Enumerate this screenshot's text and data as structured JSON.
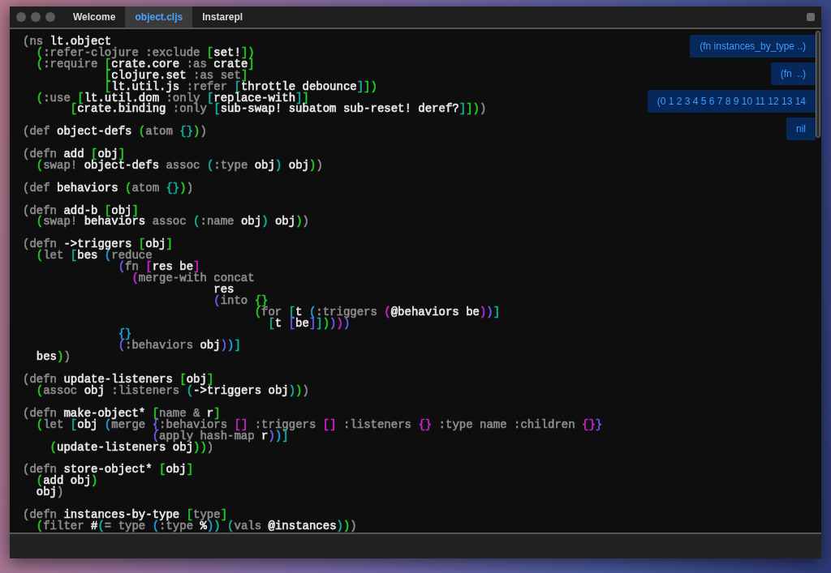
{
  "window": {
    "tabs": [
      {
        "label": "Welcome",
        "selected": false
      },
      {
        "label": "object.cljs",
        "selected": true
      },
      {
        "label": "Instarepl",
        "selected": false
      }
    ]
  },
  "editor": {
    "lines": [
      {
        "blank_before": false,
        "tokens": [
          {
            "text": "(ns ",
            "color": "#8c8c8c"
          },
          {
            "text": "lt.object",
            "color": "#e8e8e8"
          }
        ]
      },
      {
        "blank_before": false,
        "tokens": [
          {
            "text": "  (",
            "color": "#22cc22"
          },
          {
            "text": ":refer-clojure :exclude ",
            "color": "#8c8c8c"
          },
          {
            "text": "[",
            "color": "#22cc22"
          },
          {
            "text": "set!",
            "color": "#e8e8e8"
          },
          {
            "text": "])",
            "color": "#22cc22"
          }
        ]
      },
      {
        "blank_before": false,
        "tokens": [
          {
            "text": "  (",
            "color": "#22cc22"
          },
          {
            "text": ":require ",
            "color": "#8c8c8c"
          },
          {
            "text": "[",
            "color": "#22cc22"
          },
          {
            "text": "crate.core ",
            "color": "#e8e8e8"
          },
          {
            "text": ":as ",
            "color": "#8c8c8c"
          },
          {
            "text": "crate",
            "color": "#e8e8e8"
          },
          {
            "text": "]",
            "color": "#22cc22"
          }
        ]
      },
      {
        "blank_before": false,
        "tokens": [
          {
            "text": "            [",
            "color": "#22cc22"
          },
          {
            "text": "clojure.set ",
            "color": "#e8e8e8"
          },
          {
            "text": ":as set",
            "color": "#8c8c8c"
          },
          {
            "text": "]",
            "color": "#22cc22"
          }
        ]
      },
      {
        "blank_before": false,
        "tokens": [
          {
            "text": "            [",
            "color": "#22cc22"
          },
          {
            "text": "lt.util.js ",
            "color": "#e8e8e8"
          },
          {
            "text": ":refer ",
            "color": "#8c8c8c"
          },
          {
            "text": "[",
            "color": "#10b0a0"
          },
          {
            "text": "throttle debounce",
            "color": "#e8e8e8"
          },
          {
            "text": "]",
            "color": "#10b0a0"
          },
          {
            "text": "])",
            "color": "#22cc22"
          }
        ]
      },
      {
        "blank_before": false,
        "tokens": [
          {
            "text": "  (",
            "color": "#22cc22"
          },
          {
            "text": ":use ",
            "color": "#8c8c8c"
          },
          {
            "text": "[",
            "color": "#22cc22"
          },
          {
            "text": "lt.util.dom ",
            "color": "#e8e8e8"
          },
          {
            "text": ":only ",
            "color": "#8c8c8c"
          },
          {
            "text": "[",
            "color": "#10b0a0"
          },
          {
            "text": "replace-with",
            "color": "#e8e8e8"
          },
          {
            "text": "]",
            "color": "#10b0a0"
          },
          {
            "text": "]",
            "color": "#22cc22"
          }
        ]
      },
      {
        "blank_before": false,
        "tokens": [
          {
            "text": "       [",
            "color": "#22cc22"
          },
          {
            "text": "crate.binding ",
            "color": "#e8e8e8"
          },
          {
            "text": ":only ",
            "color": "#8c8c8c"
          },
          {
            "text": "[",
            "color": "#10b0a0"
          },
          {
            "text": "sub-swap! subatom sub-reset! deref?",
            "color": "#e8e8e8"
          },
          {
            "text": "]",
            "color": "#10b0a0"
          },
          {
            "text": "])",
            "color": "#22cc22"
          },
          {
            "text": ")",
            "color": "#8c8c8c"
          }
        ]
      },
      {
        "blank_before": true,
        "tokens": [
          {
            "text": "(def ",
            "color": "#8c8c8c"
          },
          {
            "text": "object-defs ",
            "color": "#e8e8e8"
          },
          {
            "text": "(",
            "color": "#22cc22"
          },
          {
            "text": "atom ",
            "color": "#8c8c8c"
          },
          {
            "text": "{}",
            "color": "#10b0a0"
          },
          {
            "text": ")",
            "color": "#22cc22"
          },
          {
            "text": ")",
            "color": "#8c8c8c"
          }
        ]
      },
      {
        "blank_before": true,
        "tokens": [
          {
            "text": "(defn ",
            "color": "#8c8c8c"
          },
          {
            "text": "add ",
            "color": "#e8e8e8"
          },
          {
            "text": "[",
            "color": "#22cc22"
          },
          {
            "text": "obj",
            "color": "#e8e8e8"
          },
          {
            "text": "]",
            "color": "#22cc22"
          }
        ]
      },
      {
        "blank_before": false,
        "tokens": [
          {
            "text": "  (",
            "color": "#22cc22"
          },
          {
            "text": "swap! ",
            "color": "#8c8c8c"
          },
          {
            "text": "object-defs ",
            "color": "#e8e8e8"
          },
          {
            "text": "assoc ",
            "color": "#8c8c8c"
          },
          {
            "text": "(",
            "color": "#10b0a0"
          },
          {
            "text": ":type ",
            "color": "#8c8c8c"
          },
          {
            "text": "obj",
            "color": "#e8e8e8"
          },
          {
            "text": ")",
            "color": "#10b0a0"
          },
          {
            "text": " obj",
            "color": "#e8e8e8"
          },
          {
            "text": ")",
            "color": "#22cc22"
          },
          {
            "text": ")",
            "color": "#8c8c8c"
          }
        ]
      },
      {
        "blank_before": true,
        "tokens": [
          {
            "text": "(def ",
            "color": "#8c8c8c"
          },
          {
            "text": "behaviors ",
            "color": "#e8e8e8"
          },
          {
            "text": "(",
            "color": "#22cc22"
          },
          {
            "text": "atom ",
            "color": "#8c8c8c"
          },
          {
            "text": "{}",
            "color": "#10b0a0"
          },
          {
            "text": ")",
            "color": "#22cc22"
          },
          {
            "text": ")",
            "color": "#8c8c8c"
          }
        ]
      },
      {
        "blank_before": true,
        "tokens": [
          {
            "text": "(defn ",
            "color": "#8c8c8c"
          },
          {
            "text": "add-b ",
            "color": "#e8e8e8"
          },
          {
            "text": "[",
            "color": "#22cc22"
          },
          {
            "text": "obj",
            "color": "#e8e8e8"
          },
          {
            "text": "]",
            "color": "#22cc22"
          }
        ]
      },
      {
        "blank_before": false,
        "tokens": [
          {
            "text": "  (",
            "color": "#22cc22"
          },
          {
            "text": "swap! ",
            "color": "#8c8c8c"
          },
          {
            "text": "behaviors ",
            "color": "#e8e8e8"
          },
          {
            "text": "assoc ",
            "color": "#8c8c8c"
          },
          {
            "text": "(",
            "color": "#10b0a0"
          },
          {
            "text": ":name ",
            "color": "#8c8c8c"
          },
          {
            "text": "obj",
            "color": "#e8e8e8"
          },
          {
            "text": ")",
            "color": "#10b0a0"
          },
          {
            "text": " obj",
            "color": "#e8e8e8"
          },
          {
            "text": ")",
            "color": "#22cc22"
          },
          {
            "text": ")",
            "color": "#8c8c8c"
          }
        ]
      },
      {
        "blank_before": true,
        "tokens": [
          {
            "text": "(defn ",
            "color": "#8c8c8c"
          },
          {
            "text": "->triggers ",
            "color": "#e8e8e8"
          },
          {
            "text": "[",
            "color": "#22cc22"
          },
          {
            "text": "obj",
            "color": "#e8e8e8"
          },
          {
            "text": "]",
            "color": "#22cc22"
          }
        ]
      },
      {
        "blank_before": false,
        "tokens": [
          {
            "text": "  (",
            "color": "#22cc22"
          },
          {
            "text": "let ",
            "color": "#8c8c8c"
          },
          {
            "text": "[",
            "color": "#10b0a0"
          },
          {
            "text": "bes ",
            "color": "#e8e8e8"
          },
          {
            "text": "(",
            "color": "#1aa0d8"
          },
          {
            "text": "reduce",
            "color": "#8c8c8c"
          }
        ]
      },
      {
        "blank_before": false,
        "tokens": [
          {
            "text": "              (",
            "color": "#6a5cf0"
          },
          {
            "text": "fn ",
            "color": "#8c8c8c"
          },
          {
            "text": "[",
            "color": "#d020d0"
          },
          {
            "text": "res be",
            "color": "#e8e8e8"
          },
          {
            "text": "]",
            "color": "#d020d0"
          }
        ]
      },
      {
        "blank_before": false,
        "tokens": [
          {
            "text": "                (",
            "color": "#d020d0"
          },
          {
            "text": "merge-with concat",
            "color": "#8c8c8c"
          }
        ]
      },
      {
        "blank_before": false,
        "tokens": [
          {
            "text": "                            res",
            "color": "#e8e8e8"
          }
        ]
      },
      {
        "blank_before": false,
        "tokens": [
          {
            "text": "                            (",
            "color": "#6a5cf0"
          },
          {
            "text": "into ",
            "color": "#8c8c8c"
          },
          {
            "text": "{}",
            "color": "#22cc22"
          }
        ]
      },
      {
        "blank_before": false,
        "tokens": [
          {
            "text": "                                  (",
            "color": "#22cc22"
          },
          {
            "text": "for ",
            "color": "#8c8c8c"
          },
          {
            "text": "[",
            "color": "#10b0a0"
          },
          {
            "text": "t ",
            "color": "#e8e8e8"
          },
          {
            "text": "(",
            "color": "#1aa0d8"
          },
          {
            "text": ":triggers ",
            "color": "#8c8c8c"
          },
          {
            "text": "(",
            "color": "#d020d0"
          },
          {
            "text": "@behaviors be",
            "color": "#e8e8e8"
          },
          {
            "text": ")",
            "color": "#d020d0"
          },
          {
            "text": ")",
            "color": "#6a5cf0"
          },
          {
            "text": "]",
            "color": "#10b0a0"
          }
        ]
      },
      {
        "blank_before": false,
        "tokens": [
          {
            "text": "                                    [",
            "color": "#10b0a0"
          },
          {
            "text": "t ",
            "color": "#e8e8e8"
          },
          {
            "text": "[",
            "color": "#6a5cf0"
          },
          {
            "text": "be",
            "color": "#e8e8e8"
          },
          {
            "text": "]",
            "color": "#6a5cf0"
          },
          {
            "text": "]",
            "color": "#10b0a0"
          },
          {
            "text": ")",
            "color": "#22cc22"
          },
          {
            "text": ")",
            "color": "#6a5cf0"
          },
          {
            "text": ")",
            "color": "#d020d0"
          },
          {
            "text": ")",
            "color": "#6a5cf0"
          }
        ]
      },
      {
        "blank_before": false,
        "tokens": [
          {
            "text": "              {}",
            "color": "#1aa0d8"
          }
        ]
      },
      {
        "blank_before": false,
        "tokens": [
          {
            "text": "              (",
            "color": "#6a5cf0"
          },
          {
            "text": ":behaviors ",
            "color": "#8c8c8c"
          },
          {
            "text": "obj",
            "color": "#e8e8e8"
          },
          {
            "text": ")",
            "color": "#6a5cf0"
          },
          {
            "text": ")",
            "color": "#1aa0d8"
          },
          {
            "text": "]",
            "color": "#10b0a0"
          }
        ]
      },
      {
        "blank_before": false,
        "tokens": [
          {
            "text": "  bes",
            "color": "#e8e8e8"
          },
          {
            "text": ")",
            "color": "#22cc22"
          },
          {
            "text": ")",
            "color": "#8c8c8c"
          }
        ]
      },
      {
        "blank_before": true,
        "tokens": [
          {
            "text": "(defn ",
            "color": "#8c8c8c"
          },
          {
            "text": "update-listeners ",
            "color": "#e8e8e8"
          },
          {
            "text": "[",
            "color": "#22cc22"
          },
          {
            "text": "obj",
            "color": "#e8e8e8"
          },
          {
            "text": "]",
            "color": "#22cc22"
          }
        ]
      },
      {
        "blank_before": false,
        "tokens": [
          {
            "text": "  (",
            "color": "#22cc22"
          },
          {
            "text": "assoc ",
            "color": "#8c8c8c"
          },
          {
            "text": "obj ",
            "color": "#e8e8e8"
          },
          {
            "text": ":listeners ",
            "color": "#8c8c8c"
          },
          {
            "text": "(",
            "color": "#10b0a0"
          },
          {
            "text": "->triggers obj",
            "color": "#e8e8e8"
          },
          {
            "text": ")",
            "color": "#10b0a0"
          },
          {
            "text": ")",
            "color": "#22cc22"
          },
          {
            "text": ")",
            "color": "#8c8c8c"
          }
        ]
      },
      {
        "blank_before": true,
        "tokens": [
          {
            "text": "(defn ",
            "color": "#8c8c8c"
          },
          {
            "text": "make-object* ",
            "color": "#e8e8e8"
          },
          {
            "text": "[",
            "color": "#22cc22"
          },
          {
            "text": "name & ",
            "color": "#8c8c8c"
          },
          {
            "text": "r",
            "color": "#e8e8e8"
          },
          {
            "text": "]",
            "color": "#22cc22"
          }
        ]
      },
      {
        "blank_before": false,
        "tokens": [
          {
            "text": "  (",
            "color": "#22cc22"
          },
          {
            "text": "let ",
            "color": "#8c8c8c"
          },
          {
            "text": "[",
            "color": "#10b0a0"
          },
          {
            "text": "obj ",
            "color": "#e8e8e8"
          },
          {
            "text": "(",
            "color": "#1aa0d8"
          },
          {
            "text": "merge ",
            "color": "#8c8c8c"
          },
          {
            "text": "{",
            "color": "#6a5cf0"
          },
          {
            "text": ":behaviors ",
            "color": "#8c8c8c"
          },
          {
            "text": "[]",
            "color": "#d020d0"
          },
          {
            "text": " :triggers ",
            "color": "#8c8c8c"
          },
          {
            "text": "[]",
            "color": "#d020d0"
          },
          {
            "text": " :listeners ",
            "color": "#8c8c8c"
          },
          {
            "text": "{}",
            "color": "#d020d0"
          },
          {
            "text": " :type name :children ",
            "color": "#8c8c8c"
          },
          {
            "text": "{}",
            "color": "#d020d0"
          },
          {
            "text": "}",
            "color": "#6a5cf0"
          }
        ]
      },
      {
        "blank_before": false,
        "tokens": [
          {
            "text": "                   (",
            "color": "#6a5cf0"
          },
          {
            "text": "apply hash-map ",
            "color": "#8c8c8c"
          },
          {
            "text": "r",
            "color": "#e8e8e8"
          },
          {
            "text": ")",
            "color": "#6a5cf0"
          },
          {
            "text": ")",
            "color": "#1aa0d8"
          },
          {
            "text": "]",
            "color": "#10b0a0"
          }
        ]
      },
      {
        "blank_before": false,
        "tokens": [
          {
            "text": "    (",
            "color": "#22cc22"
          },
          {
            "text": "update-listeners obj",
            "color": "#e8e8e8"
          },
          {
            "text": "))",
            "color": "#22cc22"
          },
          {
            "text": ")",
            "color": "#8c8c8c"
          }
        ]
      },
      {
        "blank_before": true,
        "tokens": [
          {
            "text": "(defn ",
            "color": "#8c8c8c"
          },
          {
            "text": "store-object* ",
            "color": "#e8e8e8"
          },
          {
            "text": "[",
            "color": "#22cc22"
          },
          {
            "text": "obj",
            "color": "#e8e8e8"
          },
          {
            "text": "]",
            "color": "#22cc22"
          }
        ]
      },
      {
        "blank_before": false,
        "tokens": [
          {
            "text": "  (",
            "color": "#22cc22"
          },
          {
            "text": "add obj",
            "color": "#e8e8e8"
          },
          {
            "text": ")",
            "color": "#22cc22"
          }
        ]
      },
      {
        "blank_before": false,
        "tokens": [
          {
            "text": "  obj",
            "color": "#e8e8e8"
          },
          {
            "text": ")",
            "color": "#8c8c8c"
          }
        ]
      },
      {
        "blank_before": true,
        "tokens": [
          {
            "text": "(defn ",
            "color": "#8c8c8c"
          },
          {
            "text": "instances-by-type ",
            "color": "#e8e8e8"
          },
          {
            "text": "[",
            "color": "#22cc22"
          },
          {
            "text": "type",
            "color": "#8c8c8c"
          },
          {
            "text": "]",
            "color": "#22cc22"
          }
        ]
      },
      {
        "blank_before": false,
        "tokens": [
          {
            "text": "  (",
            "color": "#22cc22"
          },
          {
            "text": "filter ",
            "color": "#8c8c8c"
          },
          {
            "text": "#",
            "color": "#e8e8e8"
          },
          {
            "text": "(",
            "color": "#10b0a0"
          },
          {
            "text": "= type ",
            "color": "#8c8c8c"
          },
          {
            "text": "(",
            "color": "#1aa0d8"
          },
          {
            "text": ":type ",
            "color": "#8c8c8c"
          },
          {
            "text": "%",
            "color": "#e8e8e8"
          },
          {
            "text": ")",
            "color": "#1aa0d8"
          },
          {
            "text": ")",
            "color": "#10b0a0"
          },
          {
            "text": " (",
            "color": "#10b0a0"
          },
          {
            "text": "vals ",
            "color": "#8c8c8c"
          },
          {
            "text": "@instances",
            "color": "#e8e8e8"
          },
          {
            "text": ")",
            "color": "#10b0a0"
          },
          {
            "text": ")",
            "color": "#22cc22"
          },
          {
            "text": ")",
            "color": "#8c8c8c"
          }
        ]
      }
    ],
    "results": [
      "(fn instances_by_type ..)",
      "(fn  ..)",
      "(0 1 2 3 4 5 6 7 8 9 10 11 12 13 14",
      "nil"
    ]
  }
}
